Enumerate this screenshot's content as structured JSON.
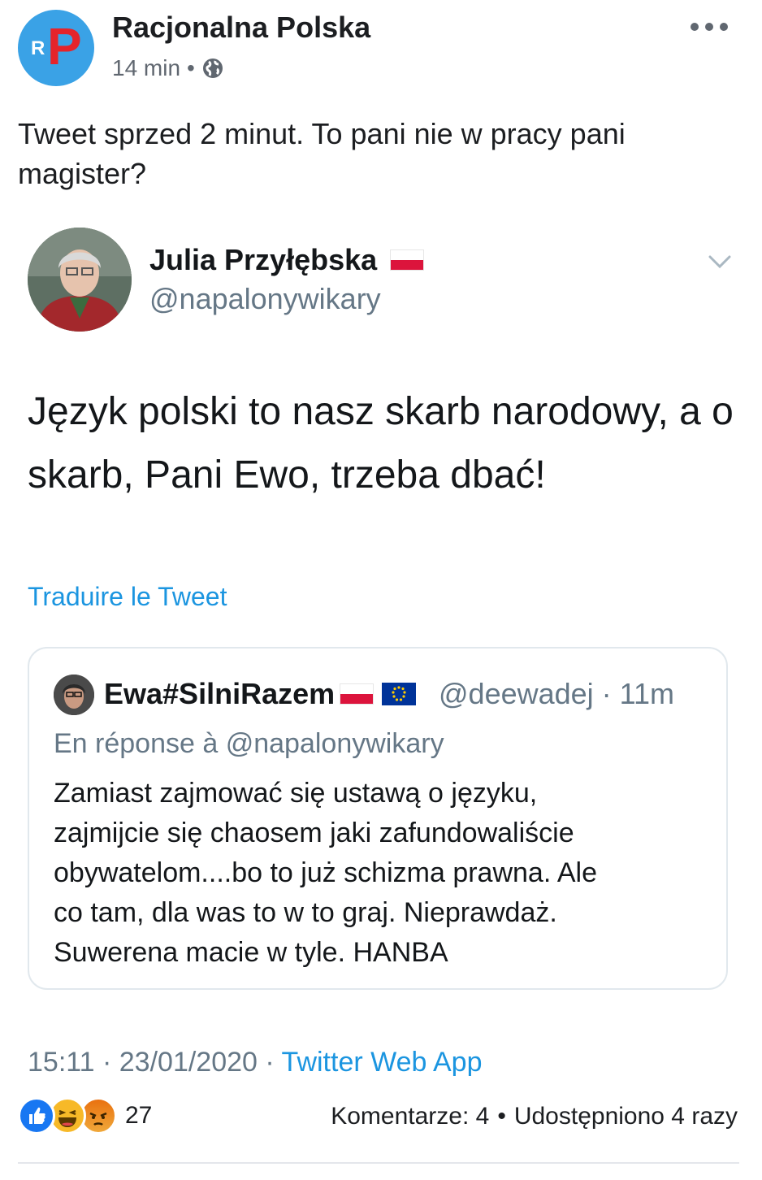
{
  "post": {
    "page_name": "Racjonalna Polska",
    "avatar_text_small": "R",
    "avatar_text_big": "P",
    "time": "14 min",
    "dot": "•",
    "privacy_icon": "globe-icon",
    "more_icon": "more-options-icon",
    "text": "Tweet sprzed 2 minut. To pani nie w pracy pani magister?"
  },
  "tweet": {
    "author_name": "Julia Przyłębska",
    "author_handle": "@napalonywikary",
    "text": "Język polski to nasz skarb narodowy, a o skarb, Pani Ewo, trzeba dbać!",
    "translate_label": "Traduire le Tweet",
    "timestamp": "15:11 · 23/01/2020 · ",
    "source": "Twitter Web App",
    "quoted": {
      "author_name": "Ewa#SilniRazem",
      "author_handle": "@deewadej · 11m",
      "reply_prefix": "En réponse à ",
      "reply_to": "@napalonywikary",
      "text": "Zamiast zajmować się ustawą o języku,\nzajmijcie się  chaosem jaki zafundowaliście\nobywatelom....bo to już schizma prawna. Ale\nco tam, dla was to w to graj. Nieprawdaż.\nSuwerena macie w tyle. HANBA"
    }
  },
  "engagement": {
    "reactions": [
      "like-icon",
      "haha-icon",
      "angry-icon"
    ],
    "reaction_count": "27",
    "comments": "Komentarze: 4",
    "separator": "•",
    "shares": "Udostępniono 4 razy"
  },
  "colors": {
    "link_blue": "#1b95e0",
    "twitter_gray": "#657786",
    "facebook_text": "#1c1e21",
    "avatar_bg": "#3aa2e6",
    "avatar_p": "#e5242b"
  }
}
